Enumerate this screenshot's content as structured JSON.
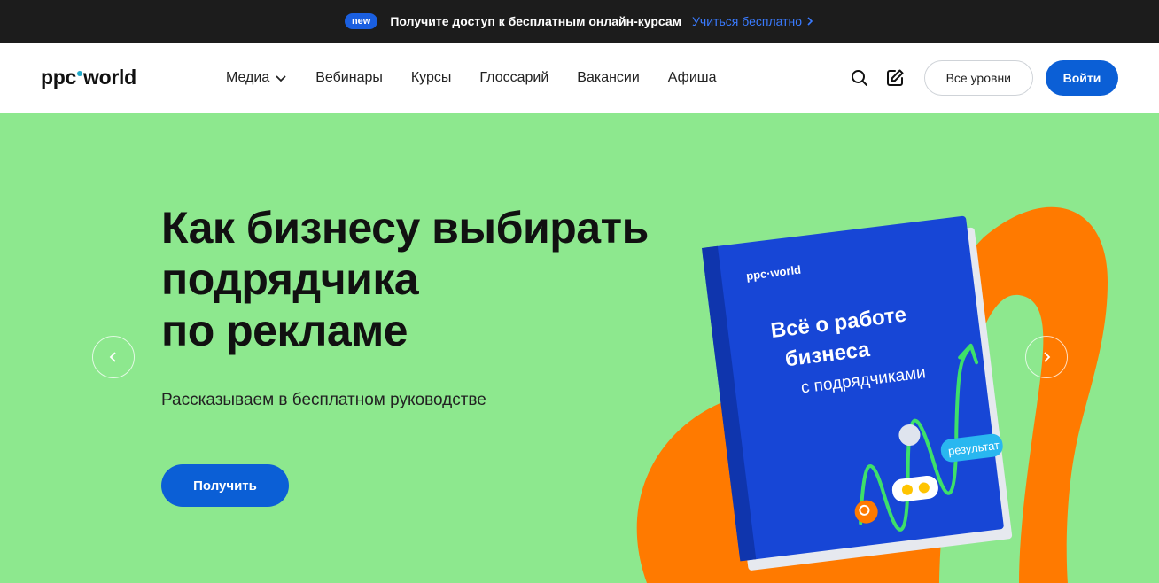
{
  "promo": {
    "badge": "new",
    "text": "Получите доступ к бесплатным онлайн-курсам",
    "link": "Учиться бесплатно"
  },
  "header": {
    "logo_left": "ppc",
    "logo_right": "world",
    "nav": [
      {
        "label": "Медиа",
        "has_dropdown": true
      },
      {
        "label": "Вебинары"
      },
      {
        "label": "Курсы"
      },
      {
        "label": "Глоссарий"
      },
      {
        "label": "Вакансии"
      },
      {
        "label": "Афиша"
      }
    ],
    "levels_button": "Все уровни",
    "login_button": "Войти"
  },
  "hero": {
    "title_lines": [
      "Как бизнесу выбирать",
      "подрядчика",
      "по рекламе"
    ],
    "subtitle": "Рассказываем в бесплатном руководстве",
    "cta": "Получить",
    "book": {
      "brand": "ppc·world",
      "title_line1": "Всё о работе",
      "title_line2": "бизнеса",
      "subtitle": "с подрядчиками",
      "tag": "результат",
      "spine": "ppc·world"
    }
  },
  "colors": {
    "hero_bg": "#8de88e",
    "primary": "#0b5fd6",
    "promo_bg": "#1c1c1c",
    "orange": "#ff7a00",
    "book_blue": "#1746d6"
  }
}
